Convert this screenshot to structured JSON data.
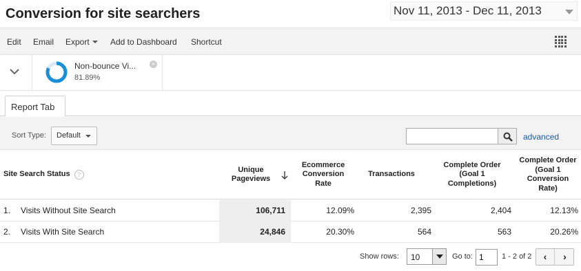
{
  "header": {
    "title": "Conversion for site searchers",
    "date_range": "Nov 11, 2013 - Dec 11, 2013"
  },
  "toolbar": {
    "edit": "Edit",
    "email": "Email",
    "export": "Export",
    "add_to_dashboard": "Add to Dashboard",
    "shortcut": "Shortcut"
  },
  "scorecard": {
    "metric_name": "Non-bounce Vi...",
    "metric_value": "81.89%",
    "accent_color": "#1a8fd6"
  },
  "tabs": [
    {
      "label": "Report Tab"
    }
  ],
  "filter": {
    "sort_label": "Sort Type:",
    "sort_value": "Default",
    "search_value": "",
    "advanced": "advanced"
  },
  "table": {
    "columns": [
      "Site Search Status",
      "Unique Pageviews",
      "Ecommerce Conversion Rate",
      "Transactions",
      "Complete Order (Goal 1 Completions)",
      "Complete Order (Goal 1 Conversion Rate)"
    ],
    "rows": [
      {
        "idx": "1.",
        "name": "Visits Without Site Search",
        "unique_pageviews": "106,711",
        "ecommerce_rate": "12.09%",
        "transactions": "2,395",
        "goal_completions": "2,404",
        "goal_rate": "12.13%"
      },
      {
        "idx": "2.",
        "name": "Visits With Site Search",
        "unique_pageviews": "24,846",
        "ecommerce_rate": "20.30%",
        "transactions": "564",
        "goal_completions": "563",
        "goal_rate": "20.26%"
      }
    ]
  },
  "pagination": {
    "show_rows_label": "Show rows:",
    "show_rows_value": "10",
    "goto_label": "Go to:",
    "goto_value": "1",
    "range_text": "1 - 2 of 2",
    "prev": "‹",
    "next": "›"
  }
}
